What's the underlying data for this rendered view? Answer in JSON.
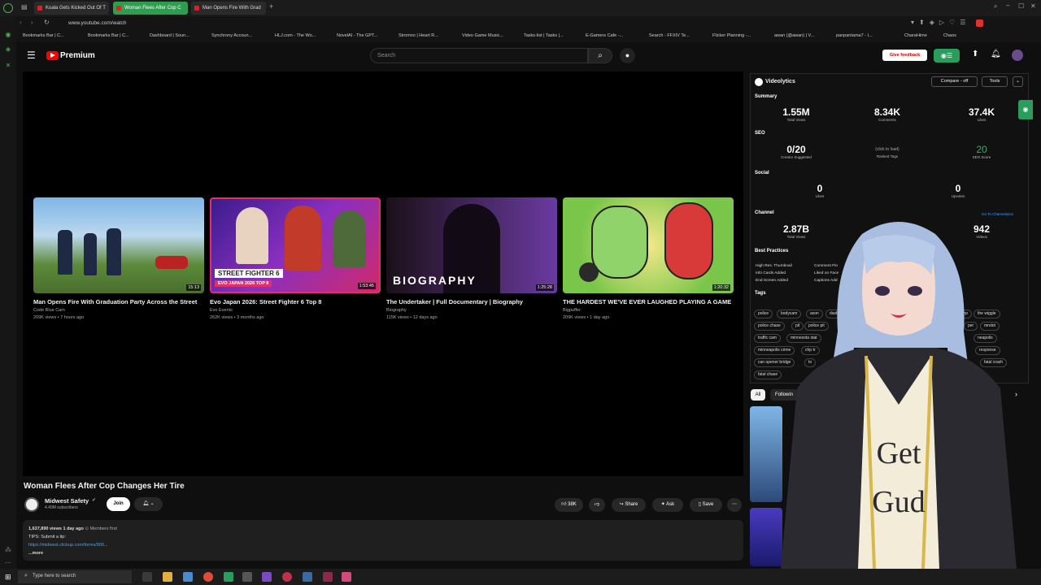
{
  "browser": {
    "tabs": [
      {
        "label": "Koala Gets Kicked Out Of T",
        "active": false
      },
      {
        "label": "Woman Flees After Cop C",
        "active": true
      },
      {
        "label": "Man Opens Fire With Grad",
        "active": false
      }
    ],
    "new_tab": "+",
    "url": "www.youtube.com/watch",
    "bookmarks": [
      "Bookmarks Bar | C...",
      "Bookmarks Bar | C...",
      "Dashboard | Soun...",
      "Synchrony Accoun...",
      "HLJ.com - The Wo...",
      "NovelAI - The GPT...",
      "Stromno | Heart R...",
      "Video Game Music...",
      "Tasks-list | Tasks |...",
      "E-Gamers Cafe -...",
      "Search - FFXIV Te...",
      "Flicker Planning -...",
      "awan (@awan) | V...",
      "panpantama7 - I...",
      "CharaHime",
      "Chaos"
    ]
  },
  "youtube": {
    "logo": "Premium",
    "search_placeholder": "Search",
    "feedback_label": "Give feedback",
    "suggestions": [
      {
        "title": "Man Opens Fire With Graduation Party Across the Street",
        "channel": "Code Blue Cam",
        "meta": "209K views • 7 hours ago",
        "duration": "15:13",
        "overlay": ""
      },
      {
        "title": "Evo Japan 2026: Street Fighter 6 Top 8",
        "channel": "Evo Events",
        "meta": "262K views • 3 months ago",
        "duration": "1:53:45",
        "overlay": "STREET FIGHTER 6",
        "overlay2": "EVO JAPAN 2026  TOP 8"
      },
      {
        "title": "The Undertaker | Full Documentary | Biography",
        "channel": "Biography",
        "meta": "115K views • 12 days ago",
        "duration": "1:25:28",
        "overlay": "BIOGRAPHY"
      },
      {
        "title": "THE HARDEST WE'VE EVER LAUGHED PLAYING A GAME",
        "channel": "Bigpuffer",
        "meta": "209K views • 1 day ago",
        "duration": "1:20:32",
        "overlay": ""
      }
    ],
    "video": {
      "title": "Woman Flees After Cop Changes Her Tire",
      "channel": "Midwest Safety",
      "subscribers": "4.49M subscribers",
      "join": "Join",
      "likes": "38K",
      "share": "Share",
      "ask": "Ask",
      "save": "Save",
      "views_line": "1,637,890 views  1 day ago",
      "members_first": "Members first",
      "tips_line": "TIPS: Submit a tip:",
      "tips_link": "https://midwest.clickup.com/forms/900...",
      "more": "...more"
    },
    "chips": {
      "all": "All",
      "next": "Followin"
    }
  },
  "videolytics": {
    "title": "Videolytics",
    "compare_label": "Compare - off",
    "tools_label": "Tools",
    "summary_label": "Summary",
    "summary": [
      {
        "value": "1.55M",
        "label": "Total Views"
      },
      {
        "value": "8.34K",
        "label": "Comments"
      },
      {
        "value": "37.4K",
        "label": "Likes"
      }
    ],
    "seo_label": "SEO",
    "seo": [
      {
        "value": "0/20",
        "label": "Creator Suggested"
      },
      {
        "value": "(click to load)",
        "label": "Ranked Tags"
      },
      {
        "value": "20",
        "label": "SEO Score"
      }
    ],
    "social_label": "Social",
    "social": [
      {
        "value": "0",
        "label": "Likes"
      },
      {
        "value": "0",
        "label": "Upvotes"
      }
    ],
    "channel_label": "Channel",
    "channel_link": "Go To Channelytics",
    "channel": [
      {
        "value": "2.87B",
        "label": "Total Views"
      },
      {
        "value": "942",
        "label": "Videos"
      }
    ],
    "best_practices_label": "Best Practices",
    "best_practices": [
      "High Res. Thumbnail",
      "Comment Pin",
      "Info Cards Added",
      "Liked on Face",
      "End Screen Added",
      "Captions Add"
    ],
    "tags_label": "Tags",
    "tags": [
      "police",
      "bodycam",
      "axon",
      "dash",
      "chp",
      "the wiggle",
      "police chase",
      "pit",
      "police pit",
      "per",
      "mndot",
      "traffic cam",
      "minnesota stat",
      "neapolis",
      "minneapolis crime",
      "chp tr",
      "response",
      "can opener bridge",
      "to",
      "fatal crash",
      "fatal chase"
    ]
  },
  "avatar": {
    "shirt_text_1": "Get",
    "shirt_text_2": "Gud"
  },
  "taskbar": {
    "search_placeholder": "Type here to search"
  },
  "colors": {
    "yt_red": "#ff0000",
    "accent_green": "#2a9d5c",
    "background": "#0f0f0f"
  }
}
